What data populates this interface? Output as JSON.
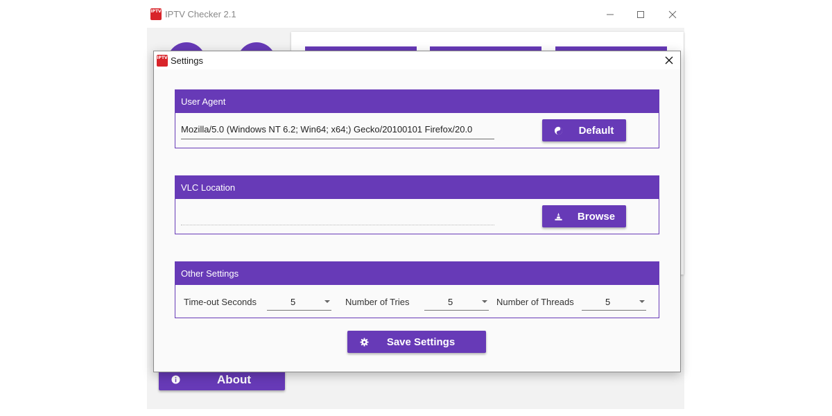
{
  "app": {
    "title": "IPTV Checker 2.1",
    "logo_text": "IPTV",
    "accent_color": "#673ab7",
    "about_label": "About",
    "window_controls": {
      "minimize_icon": "minimize-icon",
      "maximize_icon": "maximize-icon",
      "close_icon": "close-icon"
    }
  },
  "dialog": {
    "title": "Settings",
    "logo_text": "IPTV",
    "close_icon": "close-icon",
    "user_agent": {
      "header": "User Agent",
      "value": "Mozilla/5.0 (Windows NT 6.2; Win64; x64;) Gecko/20100101 Firefox/20.0",
      "button_label": "Default",
      "button_icon": "default-icon"
    },
    "vlc_location": {
      "header": "VLC Location",
      "value": "",
      "button_label": "Browse",
      "button_icon": "vlc-cone-icon"
    },
    "other_settings": {
      "header": "Other Settings",
      "timeout_label": "Time-out Seconds",
      "timeout_value": "5",
      "tries_label": "Number of Tries",
      "tries_value": "5",
      "threads_label": "Number of Threads",
      "threads_value": "5"
    },
    "save_label": "Save Settings",
    "save_icon": "gear-icon"
  }
}
